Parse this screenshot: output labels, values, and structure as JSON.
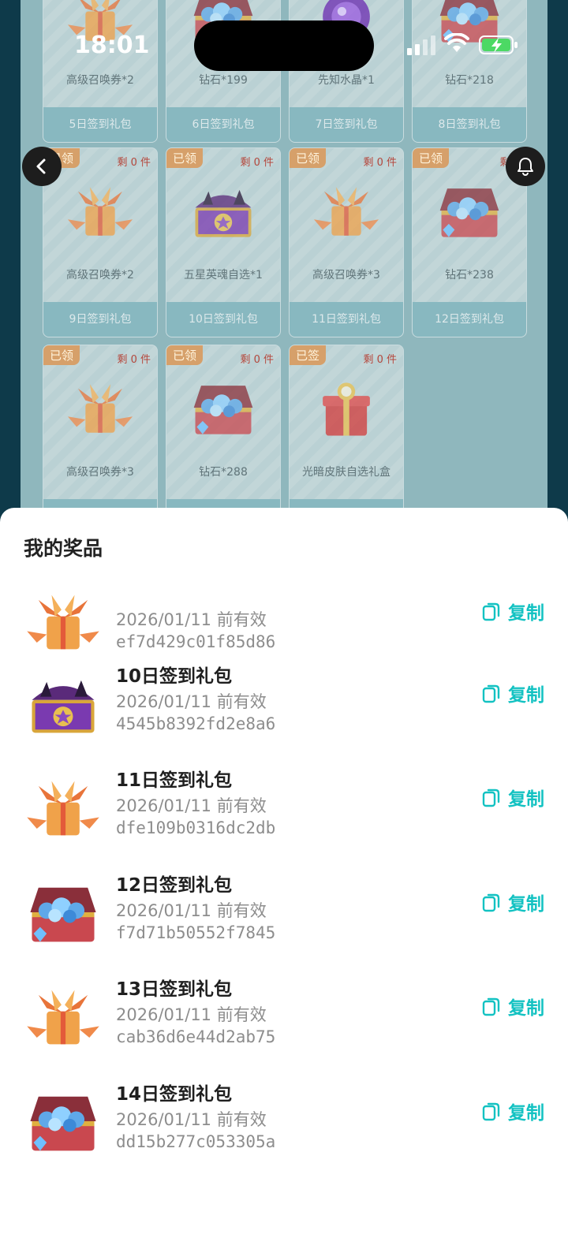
{
  "status_bar": {
    "time": "18:01"
  },
  "grid": {
    "cards": [
      {
        "tag": "",
        "left": "",
        "prize": "高级召唤券*2",
        "footer": "5日签到礼包",
        "art": "tickets"
      },
      {
        "tag": "",
        "left": "",
        "prize": "钻石*199",
        "footer": "6日签到礼包",
        "art": "diamond"
      },
      {
        "tag": "",
        "left": "",
        "prize": "先知水晶*1",
        "footer": "7日签到礼包",
        "art": "crystal"
      },
      {
        "tag": "",
        "left": "",
        "prize": "钻石*218",
        "footer": "8日签到礼包",
        "art": "diamond"
      },
      {
        "tag": "已领",
        "left": "剩 0 件",
        "prize": "高级召唤券*2",
        "footer": "9日签到礼包",
        "art": "tickets"
      },
      {
        "tag": "已领",
        "left": "剩 0 件",
        "prize": "五星英魂自选*1",
        "footer": "10日签到礼包",
        "art": "chest"
      },
      {
        "tag": "已领",
        "left": "剩 0 件",
        "prize": "高级召唤券*3",
        "footer": "11日签到礼包",
        "art": "tickets"
      },
      {
        "tag": "已领",
        "left": "剩 0",
        "prize": "钻石*238",
        "footer": "12日签到礼包",
        "art": "diamond"
      },
      {
        "tag": "已领",
        "left": "剩 0 件",
        "prize": "高级召唤券*3",
        "footer": "",
        "art": "tickets"
      },
      {
        "tag": "已领",
        "left": "剩 0 件",
        "prize": "钻石*288",
        "footer": "",
        "art": "diamond"
      },
      {
        "tag": "已签",
        "left": "剩 0 件",
        "prize": "光暗皮肤自选礼盒",
        "footer": "",
        "art": "giftbox"
      }
    ]
  },
  "sheet": {
    "title": "我的奖品",
    "copy_label": "复制",
    "items": [
      {
        "title": "",
        "date": "2026/01/11 前有效",
        "code": "ef7d429c01f85d86",
        "art": "tickets"
      },
      {
        "title": "10日签到礼包",
        "date": "2026/01/11 前有效",
        "code": "4545b8392fd2e8a6",
        "art": "chest"
      },
      {
        "title": "11日签到礼包",
        "date": "2026/01/11 前有效",
        "code": "dfe109b0316dc2db",
        "art": "tickets"
      },
      {
        "title": "12日签到礼包",
        "date": "2026/01/11 前有效",
        "code": "f7d71b50552f7845",
        "art": "diamond"
      },
      {
        "title": "13日签到礼包",
        "date": "2026/01/11 前有效",
        "code": "cab36d6e44d2ab75",
        "art": "tickets"
      },
      {
        "title": "14日签到礼包",
        "date": "2026/01/11 前有效",
        "code": "dd15b277c053305a",
        "art": "diamond"
      }
    ]
  },
  "colors": {
    "accent": "#13c2c2",
    "tag": "#d6a06a"
  }
}
